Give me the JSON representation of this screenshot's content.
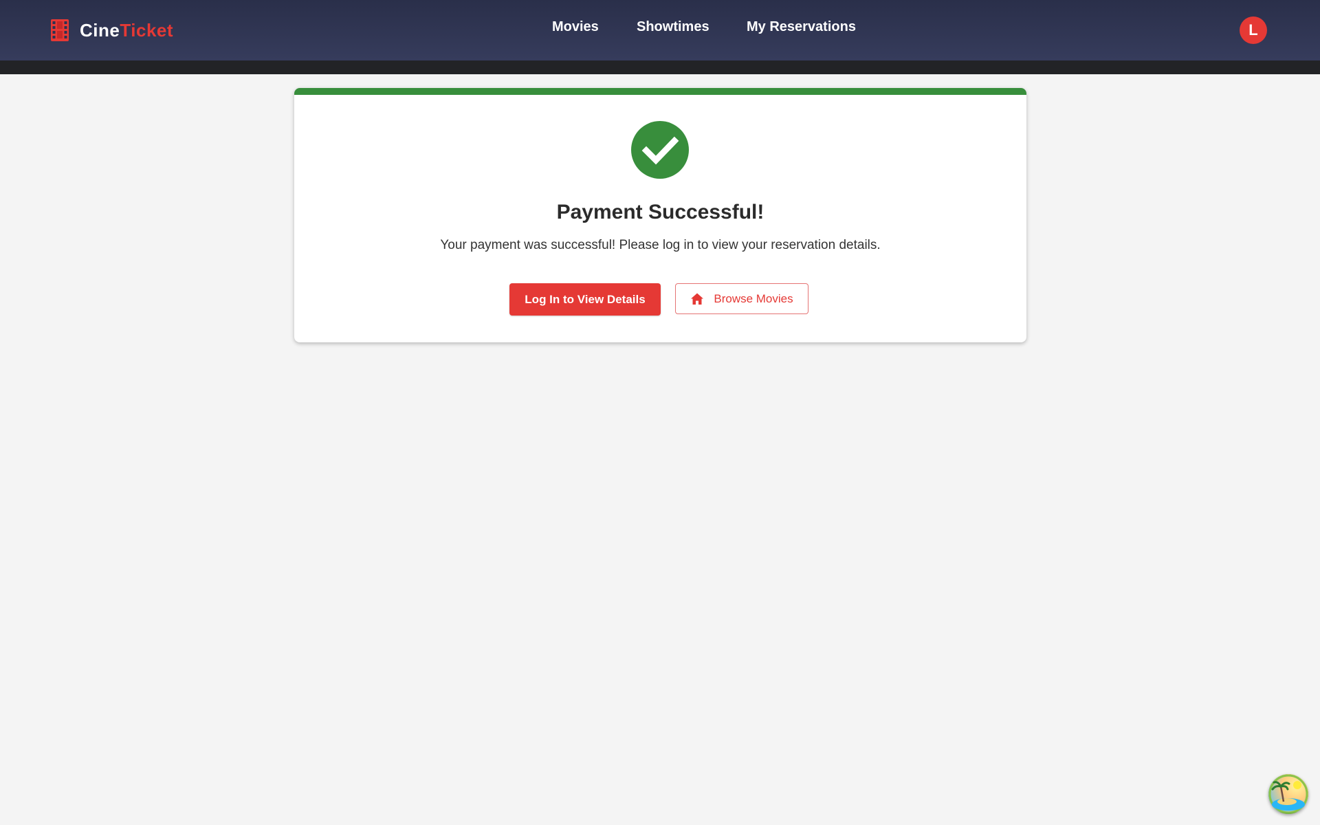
{
  "brand": {
    "name_part1": "Cine",
    "name_part2": "Ticket",
    "icon": "film-icon"
  },
  "nav": {
    "items": [
      {
        "label": "Movies"
      },
      {
        "label": "Showtimes"
      },
      {
        "label": "My Reservations"
      }
    ]
  },
  "user": {
    "avatar_initial": "L"
  },
  "card": {
    "icon": "check-circle-icon",
    "title": "Payment Successful!",
    "message": "Your payment was successful! Please log in to view your reservation details.",
    "primary_button": "Log In to View Details",
    "secondary_button": "Browse Movies",
    "secondary_icon": "home-icon"
  },
  "floating_widget": {
    "icon": "tropical-island-icon"
  },
  "colors": {
    "accent": "#e53935",
    "success": "#388e3c",
    "header_bg": "#303553",
    "page_bg": "#f4f4f4"
  }
}
